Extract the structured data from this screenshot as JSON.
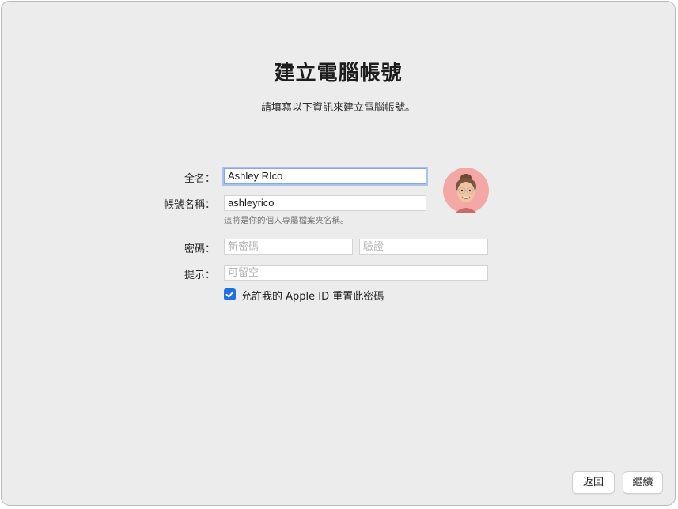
{
  "header": {
    "title": "建立電腦帳號",
    "subtitle": "請填寫以下資訊來建立電腦帳號。"
  },
  "form": {
    "full_name": {
      "label": "全名：",
      "value": "Ashley RIco"
    },
    "account_name": {
      "label": "帳號名稱：",
      "value": "ashleyrico",
      "helper": "這將是你的個人專屬檔案夾名稱。"
    },
    "password": {
      "label": "密碼：",
      "new_placeholder": "新密碼",
      "verify_placeholder": "驗證"
    },
    "hint": {
      "label": "提示：",
      "placeholder": "可留空"
    },
    "allow_reset": {
      "label": "允許我的 Apple ID 重置此密碼",
      "checked": true
    }
  },
  "avatar": {
    "icon": "memoji-avatar-icon",
    "background": "#f4a8a6"
  },
  "footer": {
    "back_label": "返回",
    "continue_label": "繼續"
  },
  "colors": {
    "accent": "#1f6fe5",
    "focus_ring": "#a9c0f0",
    "window_bg": "#ececec"
  }
}
